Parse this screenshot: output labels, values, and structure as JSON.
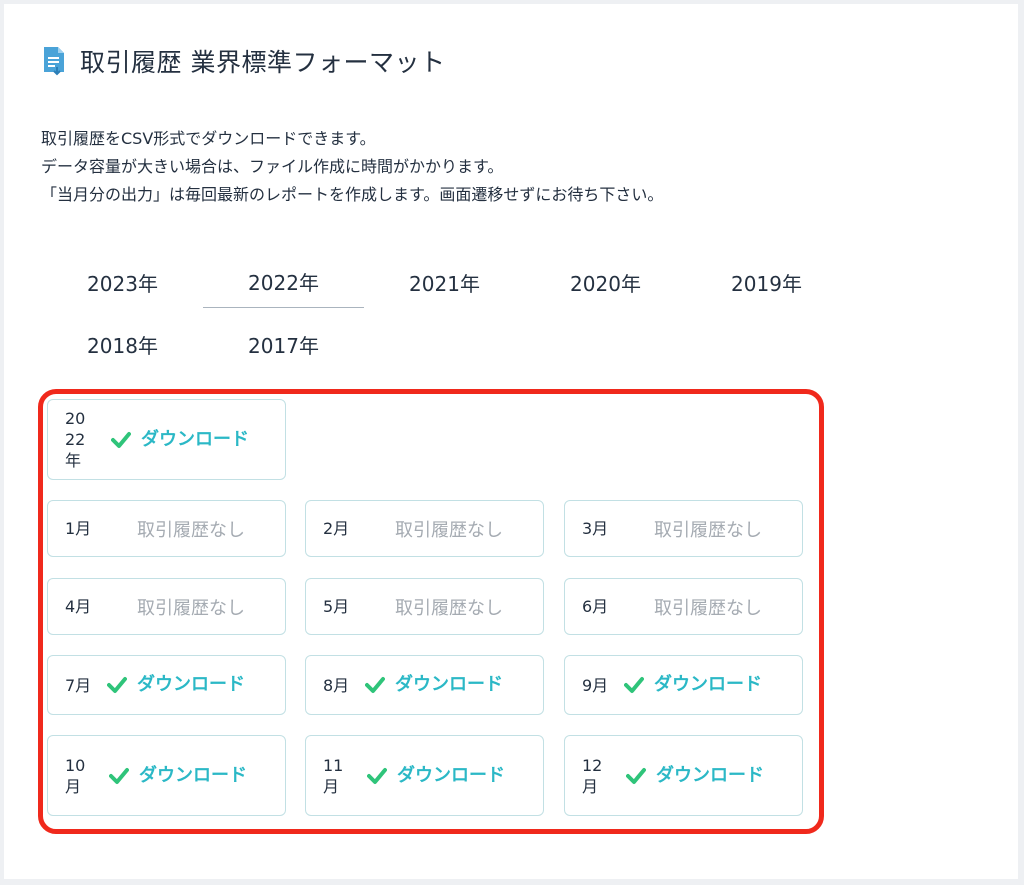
{
  "header": {
    "title": "取引履歴 業界標準フォーマット",
    "icon": "document-download-icon"
  },
  "description": [
    "取引履歴をCSV形式でダウンロードできます。",
    "データ容量が大きい場合は、ファイル作成に時間がかかります。",
    "「当月分の出力」は毎回最新のレポートを作成します。画面遷移せずにお待ち下さい。"
  ],
  "year_tabs": [
    {
      "label": "2023年",
      "active": false
    },
    {
      "label": "2022年",
      "active": true
    },
    {
      "label": "2021年",
      "active": false
    },
    {
      "label": "2020年",
      "active": false
    },
    {
      "label": "2019年",
      "active": false
    },
    {
      "label": "2018年",
      "active": false
    },
    {
      "label": "2017年",
      "active": false
    }
  ],
  "year_download": {
    "label": "2022年",
    "action": "ダウンロード"
  },
  "months": [
    {
      "label": "1月",
      "status": "取引履歴なし"
    },
    {
      "label": "2月",
      "status": "取引履歴なし"
    },
    {
      "label": "3月",
      "status": "取引履歴なし"
    },
    {
      "label": "4月",
      "status": "取引履歴なし"
    },
    {
      "label": "5月",
      "status": "取引履歴なし"
    },
    {
      "label": "6月",
      "status": "取引履歴なし"
    },
    {
      "label": "7月",
      "status": "ダウンロード"
    },
    {
      "label": "8月",
      "status": "ダウンロード"
    },
    {
      "label": "9月",
      "status": "ダウンロード"
    },
    {
      "label": "10月",
      "status": "ダウンロード"
    },
    {
      "label": "11月",
      "status": "ダウンロード"
    },
    {
      "label": "12月",
      "status": "ダウンロード"
    }
  ],
  "colors": {
    "accent": "#2bb8c6",
    "check": "#2fc47a",
    "highlight": "#f0291c",
    "muted": "#a5abb2"
  }
}
